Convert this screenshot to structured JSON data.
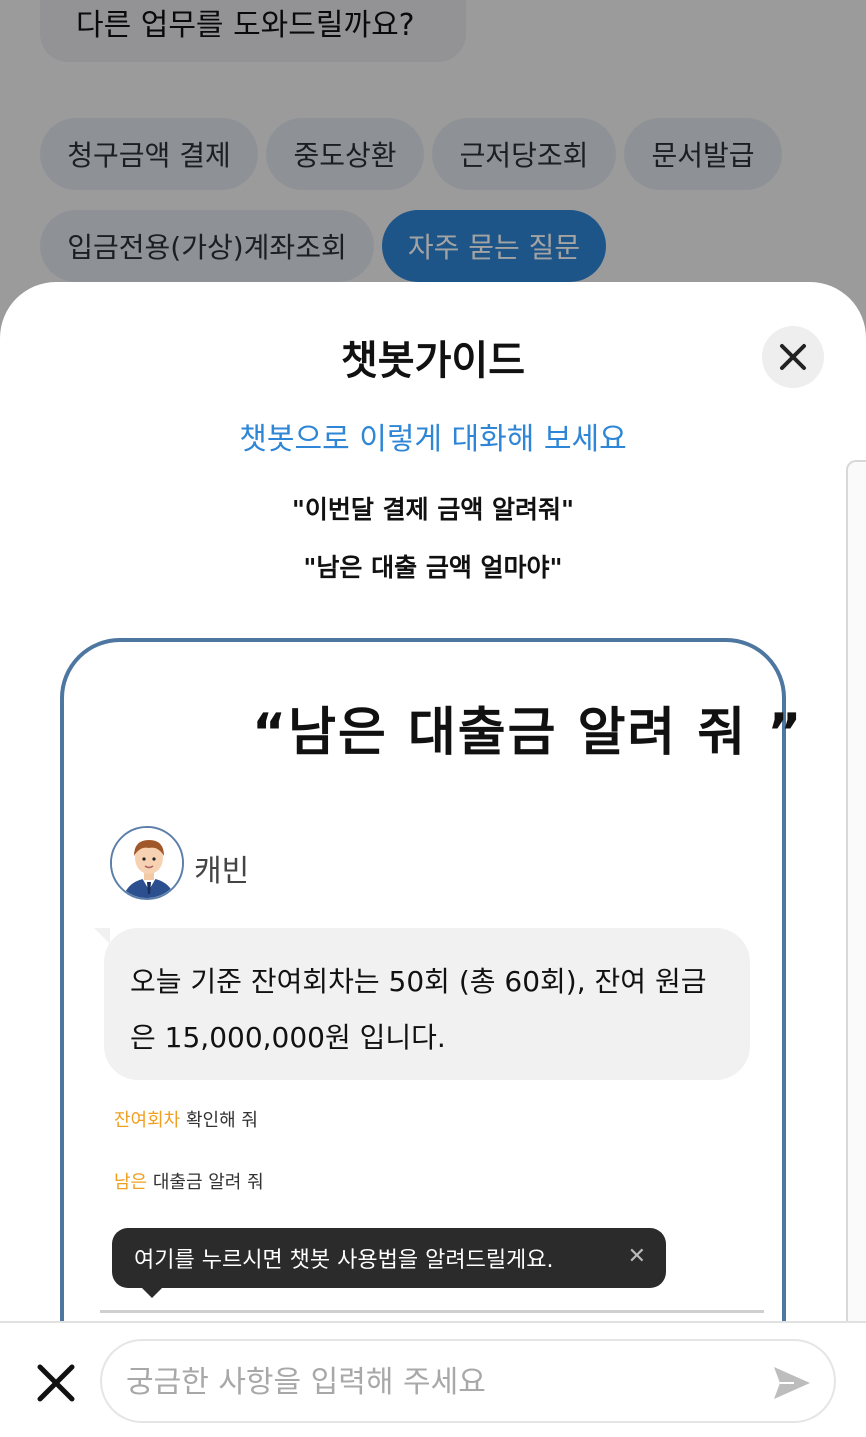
{
  "background": {
    "previous_message": "다른 업무를 도와드릴까요?",
    "quick_menu": [
      {
        "label": "청구금액 결제"
      },
      {
        "label": "중도상환"
      },
      {
        "label": "근저당조회"
      },
      {
        "label": "문서발급"
      },
      {
        "label": "입금전용(가상)계좌조회"
      },
      {
        "label": "자주 묻는 질문",
        "active": true
      }
    ]
  },
  "guide": {
    "title": "챗봇가이드",
    "subtitle": "챗봇으로 이렇게 대화해 보세요",
    "examples": [
      "\"이번달 결제 금액 알려줘\"",
      "\"남은 대출 금액 얼마야\""
    ],
    "image": {
      "quote": "“남은 대출금 알려 줘 ”",
      "bot_name": "캐빈",
      "answer": "오늘 기준 잔여회차는 50회 (총 60회), 잔여 원금은 15,000,000원 입니다.",
      "suggestions": [
        {
          "highlight": "잔여회차",
          "rest": " 확인해 줘"
        },
        {
          "highlight": "남은",
          "rest": " 대출금 알려 줘"
        }
      ],
      "tooltip": "여기를 누르시면 챗봇 사용법을 알려드릴게요."
    }
  },
  "input": {
    "placeholder": "궁금한 사항을 입력해 주세요",
    "value": ""
  },
  "colors": {
    "accent": "#2f86d6",
    "highlight": "#f0a020",
    "card_border": "#4d76a0"
  },
  "icons": {
    "sheet_close": "close-icon",
    "bar_close": "close-icon",
    "send": "send-icon",
    "tooltip_close": "close-icon"
  }
}
